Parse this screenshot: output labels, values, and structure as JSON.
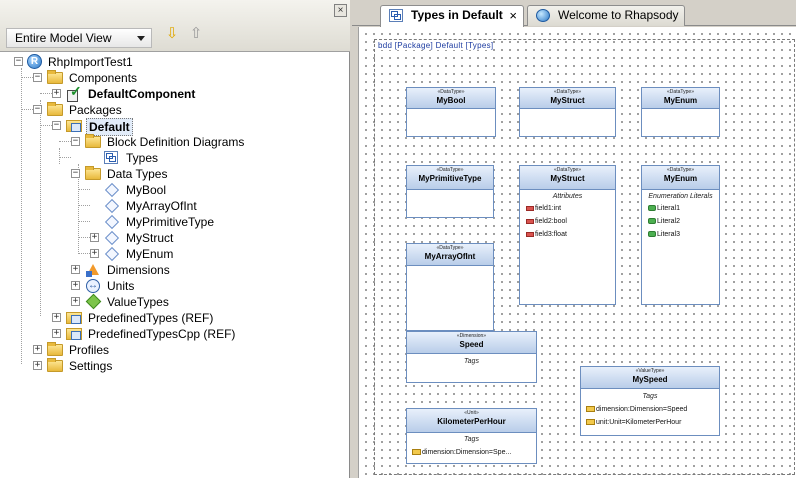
{
  "browser": {
    "close_glyph": "×",
    "view_select": "Entire Model View",
    "tree": {
      "root": "RhpImportTest1",
      "components": "Components",
      "default_component": "DefaultComponent",
      "packages": "Packages",
      "default": "Default",
      "bdd_folder": "Block Definition Diagrams",
      "types_diagram": "Types",
      "data_types": "Data Types",
      "dt_items": [
        "MyBool",
        "MyArrayOfInt",
        "MyPrimitiveType",
        "MyStruct",
        "MyEnum"
      ],
      "dimensions": "Dimensions",
      "units": "Units",
      "value_types": "ValueTypes",
      "predefined_types": "PredefinedTypes (REF)",
      "predefined_types_cpp": "PredefinedTypesCpp (REF)",
      "profiles": "Profiles",
      "settings": "Settings"
    }
  },
  "tabs": [
    {
      "label": "Types in Default",
      "close": "×"
    },
    {
      "label": "Welcome to Rhapsody"
    }
  ],
  "diagram": {
    "frame_label": "bdd [Package] Default [Types]",
    "blocks": {
      "mybool": {
        "stereotype": "«DataType»",
        "name": "MyBool"
      },
      "mystruct_top": {
        "stereotype": "«DataType»",
        "name": "MyStruct"
      },
      "myenum_top": {
        "stereotype": "«DataType»",
        "name": "MyEnum"
      },
      "myprimitive": {
        "stereotype": "«DataType»",
        "name": "MyPrimitiveType"
      },
      "mystruct": {
        "stereotype": "«DataType»",
        "name": "MyStruct",
        "section": "Attributes",
        "rows": [
          "field1:int",
          "field2:bool",
          "field3:float"
        ]
      },
      "myenum": {
        "stereotype": "«DataType»",
        "name": "MyEnum",
        "section": "Enumeration Literals",
        "rows": [
          "Literal1",
          "Literal2",
          "Literal3"
        ]
      },
      "myarray": {
        "stereotype": "«DataType»",
        "name": "MyArrayOfInt"
      },
      "speed": {
        "stereotype": "«Dimension»",
        "name": "Speed",
        "section": "Tags"
      },
      "myspeed": {
        "stereotype": "«ValueType»",
        "name": "MySpeed",
        "section": "Tags",
        "rows": [
          "dimension:Dimension=Speed",
          "unit:Unit=KilometerPerHour"
        ]
      },
      "kmh": {
        "stereotype": "«Unit»",
        "name": "KilometerPerHour",
        "section": "Tags",
        "rows": [
          "dimension:Dimension=Spe..."
        ]
      }
    }
  }
}
